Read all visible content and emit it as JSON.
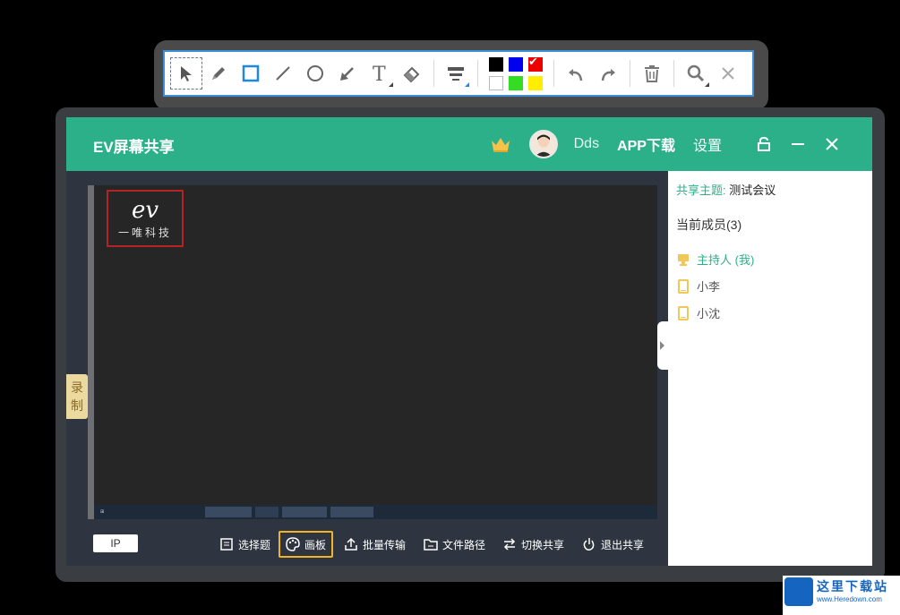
{
  "toolbar": {
    "tools": [
      "select-tool",
      "pen-tool",
      "rectangle-tool",
      "line-tool",
      "circle-tool",
      "arrow-tool",
      "text-tool",
      "eraser-tool",
      "line-width-tool"
    ],
    "colors": [
      "#000000",
      "#0000ff",
      "#ff0000",
      "#ffffff",
      "#33cc33",
      "#ffee00"
    ],
    "selected_color": "#ff0000",
    "actions": [
      "undo-icon",
      "redo-icon",
      "delete-icon",
      "zoom-icon",
      "close-icon"
    ]
  },
  "window": {
    "title": "EV屏幕共享",
    "username": "Dds",
    "app_download": "APP下载",
    "settings": "设置",
    "accent_color": "#2bb08a"
  },
  "preview": {
    "logo_ev": "ev",
    "logo_text": "一唯科技"
  },
  "record_tab": "录制",
  "sidepanel": {
    "topic_label": "共享主题:",
    "topic_value": "测试会议",
    "members_heading": "当前成员(3)",
    "members": [
      {
        "name": "主持人 (我)",
        "role": "host"
      },
      {
        "name": "小李",
        "role": "member"
      },
      {
        "name": "小沈",
        "role": "member"
      }
    ]
  },
  "bottombar": {
    "ip_label": "IP",
    "buttons": [
      {
        "label": "选择题",
        "icon": "list-icon"
      },
      {
        "label": "画板",
        "icon": "palette-icon",
        "active": true
      },
      {
        "label": "批量传输",
        "icon": "upload-icon"
      },
      {
        "label": "文件路径",
        "icon": "folder-icon"
      },
      {
        "label": "切换共享",
        "icon": "switch-icon"
      },
      {
        "label": "退出共享",
        "icon": "power-icon"
      }
    ]
  },
  "watermark": {
    "title": "这里下载站",
    "url": "www.Heredown.com"
  }
}
